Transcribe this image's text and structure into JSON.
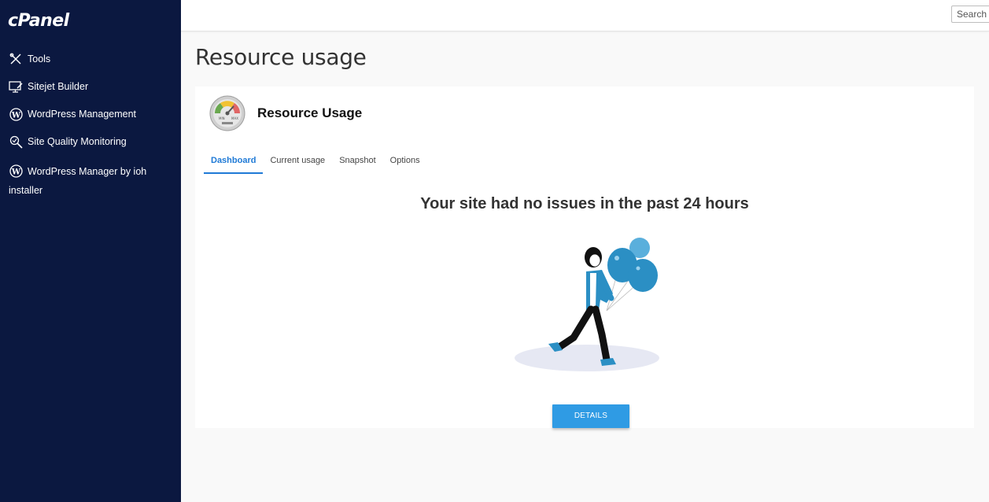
{
  "sidebar": {
    "logo": "cPanel",
    "items": [
      {
        "label": "Tools",
        "icon": "tools-icon"
      },
      {
        "label": "Sitejet Builder",
        "icon": "monitor-pen-icon"
      },
      {
        "label": "WordPress Management",
        "icon": "wordpress-icon"
      },
      {
        "label": "Site Quality Monitoring",
        "icon": "magnify-check-icon"
      },
      {
        "label": "WordPress Manager by ioh installer",
        "icon": "wordpress-icon"
      }
    ]
  },
  "topbar": {
    "search_placeholder": "Search"
  },
  "page": {
    "title": "Resource usage"
  },
  "app": {
    "title": "Resource Usage",
    "icon": "gauge-icon",
    "gauge_labels": {
      "min": "MIN",
      "max": "MAX"
    }
  },
  "tabs": [
    {
      "label": "Dashboard",
      "active": true
    },
    {
      "label": "Current usage",
      "active": false
    },
    {
      "label": "Snapshot",
      "active": false
    },
    {
      "label": "Options",
      "active": false
    }
  ],
  "dashboard": {
    "headline": "Your site had no issues in the past 24 hours",
    "details_button": "DETAILS"
  },
  "colors": {
    "sidebar_bg": "#0b1840",
    "accent": "#1f7ad6",
    "button": "#2f9be4",
    "balloon": "#2b8fc4"
  }
}
